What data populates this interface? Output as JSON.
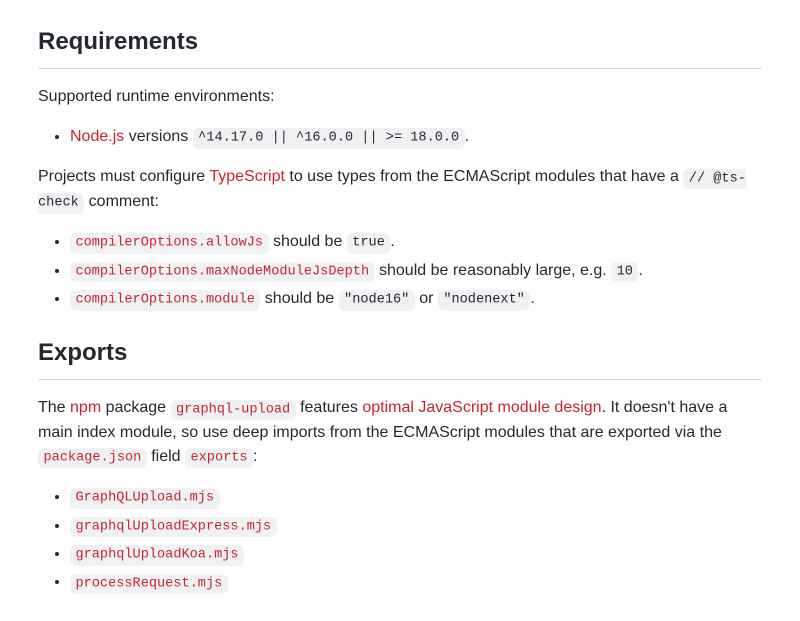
{
  "sections": {
    "requirements": {
      "heading": "Requirements",
      "intro": "Supported runtime environments:",
      "runtime": {
        "nodejs_label": "Node.js",
        "versions_text": " versions ",
        "versions_code": "^14.17.0 || ^16.0.0 || >= 18.0.0",
        "period": "."
      },
      "ts_para": {
        "pre": "Projects must configure ",
        "typescript_label": "TypeScript",
        "post": " to use types from the ECMAScript modules that have a ",
        "comment_code": "// @ts-check",
        "tail": " comment:"
      },
      "options": [
        {
          "key": "compilerOptions.allowJs",
          "mid": " should be ",
          "val": "true",
          "tail": "."
        },
        {
          "key": "compilerOptions.maxNodeModuleJsDepth",
          "mid": " should be reasonably large, e.g. ",
          "val": "10",
          "tail": "."
        },
        {
          "key": "compilerOptions.module",
          "mid": " should be ",
          "val": "\"node16\"",
          "or": " or ",
          "val2": "\"nodenext\"",
          "tail": "."
        }
      ]
    },
    "exports": {
      "heading": "Exports",
      "para": {
        "pre": "The ",
        "npm_label": "npm",
        "mid1": " package ",
        "pkg_code": "graphql-upload",
        "mid2": " features ",
        "design_label": "optimal JavaScript module design",
        "mid3": ". It doesn't have a main index module, so use deep imports from the ECMAScript modules that are exported via the ",
        "pkgjson_code": "package.json",
        "mid4": " field ",
        "exports_code": "exports",
        "tail": ":"
      },
      "modules": [
        "GraphQLUpload.mjs",
        "graphqlUploadExpress.mjs",
        "graphqlUploadKoa.mjs",
        "processRequest.mjs"
      ]
    }
  }
}
